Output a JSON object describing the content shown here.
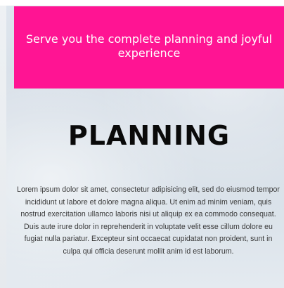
{
  "banner": {
    "text": "Serve you the complete planning and joyful experience"
  },
  "section": {
    "title": "PLANNING",
    "body": "Lorem ipsum dolor sit amet, consectetur adipisicing elit, sed do eiusmod tempor incididunt ut labore et dolore magna aliqua. Ut enim ad minim veniam, quis nostrud exercitation ullamco laboris nisi ut aliquip ex ea commodo consequat. Duis aute irure dolor in reprehenderit in voluptate velit esse cillum dolore eu fugiat nulla pariatur. Excepteur sint occaecat cupidatat non proident, sunt in culpa qui officia deserunt mollit anim id est laborum."
  },
  "colors": {
    "banner_bg": "#ff1493",
    "banner_text": "#ffffff",
    "title": "#0a0a0a",
    "body_text": "#3a3a3a"
  }
}
